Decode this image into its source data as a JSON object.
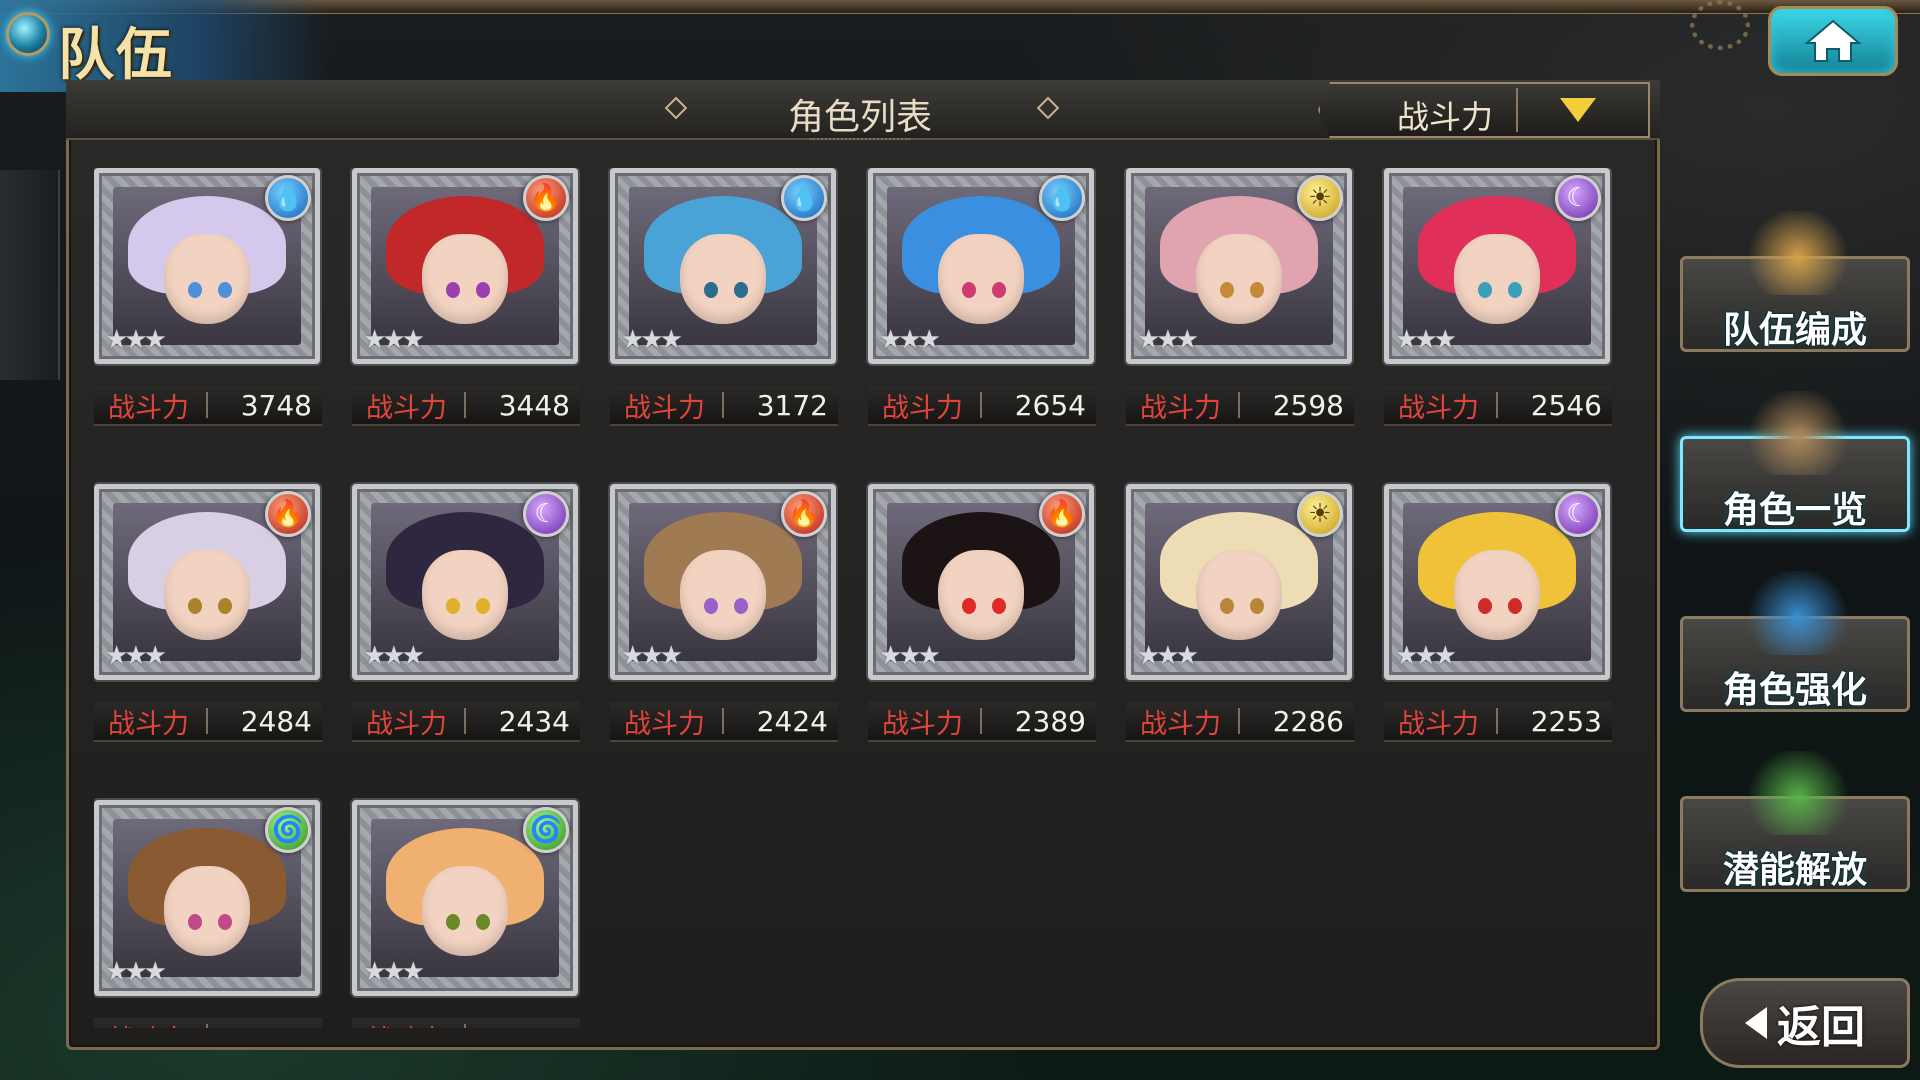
{
  "screen_title": "队伍",
  "panel_title": "角色列表",
  "sort": {
    "selected": "战斗力"
  },
  "power_label": "战斗力",
  "characters": [
    {
      "element": "water",
      "element_glyph": "💧",
      "power": "3748",
      "stars": 3,
      "hair": "#d4c8ec",
      "eyes": "#4d8fd8"
    },
    {
      "element": "fire",
      "element_glyph": "🔥",
      "power": "3448",
      "stars": 3,
      "hair": "#c0282a",
      "eyes": "#9b3fb0"
    },
    {
      "element": "water",
      "element_glyph": "💧",
      "power": "3172",
      "stars": 3,
      "hair": "#4aa3d6",
      "eyes": "#2b6c8f"
    },
    {
      "element": "water",
      "element_glyph": "💧",
      "power": "2654",
      "stars": 3,
      "hair": "#3b8fe0",
      "eyes": "#d03b6f"
    },
    {
      "element": "light",
      "element_glyph": "☀",
      "power": "2598",
      "stars": 3,
      "hair": "#e0a3b0",
      "eyes": "#c48a3a"
    },
    {
      "element": "dark",
      "element_glyph": "☾",
      "power": "2546",
      "stars": 3,
      "hair": "#e0305a",
      "eyes": "#3aa0b8"
    },
    {
      "element": "fire",
      "element_glyph": "🔥",
      "power": "2484",
      "stars": 3,
      "hair": "#d9cfe4",
      "eyes": "#a8842a"
    },
    {
      "element": "dark",
      "element_glyph": "☾",
      "power": "2434",
      "stars": 3,
      "hair": "#2f2740",
      "eyes": "#e0b02a"
    },
    {
      "element": "fire",
      "element_glyph": "🔥",
      "power": "2424",
      "stars": 3,
      "hair": "#a07a52",
      "eyes": "#9b5fc8"
    },
    {
      "element": "fire",
      "element_glyph": "🔥",
      "power": "2389",
      "stars": 3,
      "hair": "#1c1414",
      "eyes": "#e02a2a"
    },
    {
      "element": "light",
      "element_glyph": "☀",
      "power": "2286",
      "stars": 3,
      "hair": "#eedcb4",
      "eyes": "#b8863a"
    },
    {
      "element": "dark",
      "element_glyph": "☾",
      "power": "2253",
      "stars": 3,
      "hair": "#f0c23a",
      "eyes": "#d02a2a"
    },
    {
      "element": "wind",
      "element_glyph": "🌀",
      "power": "",
      "stars": 3,
      "hair": "#8a5a32",
      "eyes": "#c04a8a"
    },
    {
      "element": "wind",
      "element_glyph": "🌀",
      "power": "",
      "stars": 3,
      "hair": "#f0b070",
      "eyes": "#6a8a2a"
    }
  ],
  "side_menu": [
    {
      "label": "队伍编成",
      "icon": "team-formation-icon",
      "active": false
    },
    {
      "label": "角色一览",
      "icon": "character-book-icon",
      "active": true
    },
    {
      "label": "角色强化",
      "icon": "character-enhance-icon",
      "active": false
    },
    {
      "label": "潜能解放",
      "icon": "potential-release-icon",
      "active": false
    }
  ],
  "back_label": "返回",
  "colors": {
    "accent_gold": "#c9b48a",
    "power_label": "#e0443a",
    "active_glow": "#7fe7ff"
  }
}
